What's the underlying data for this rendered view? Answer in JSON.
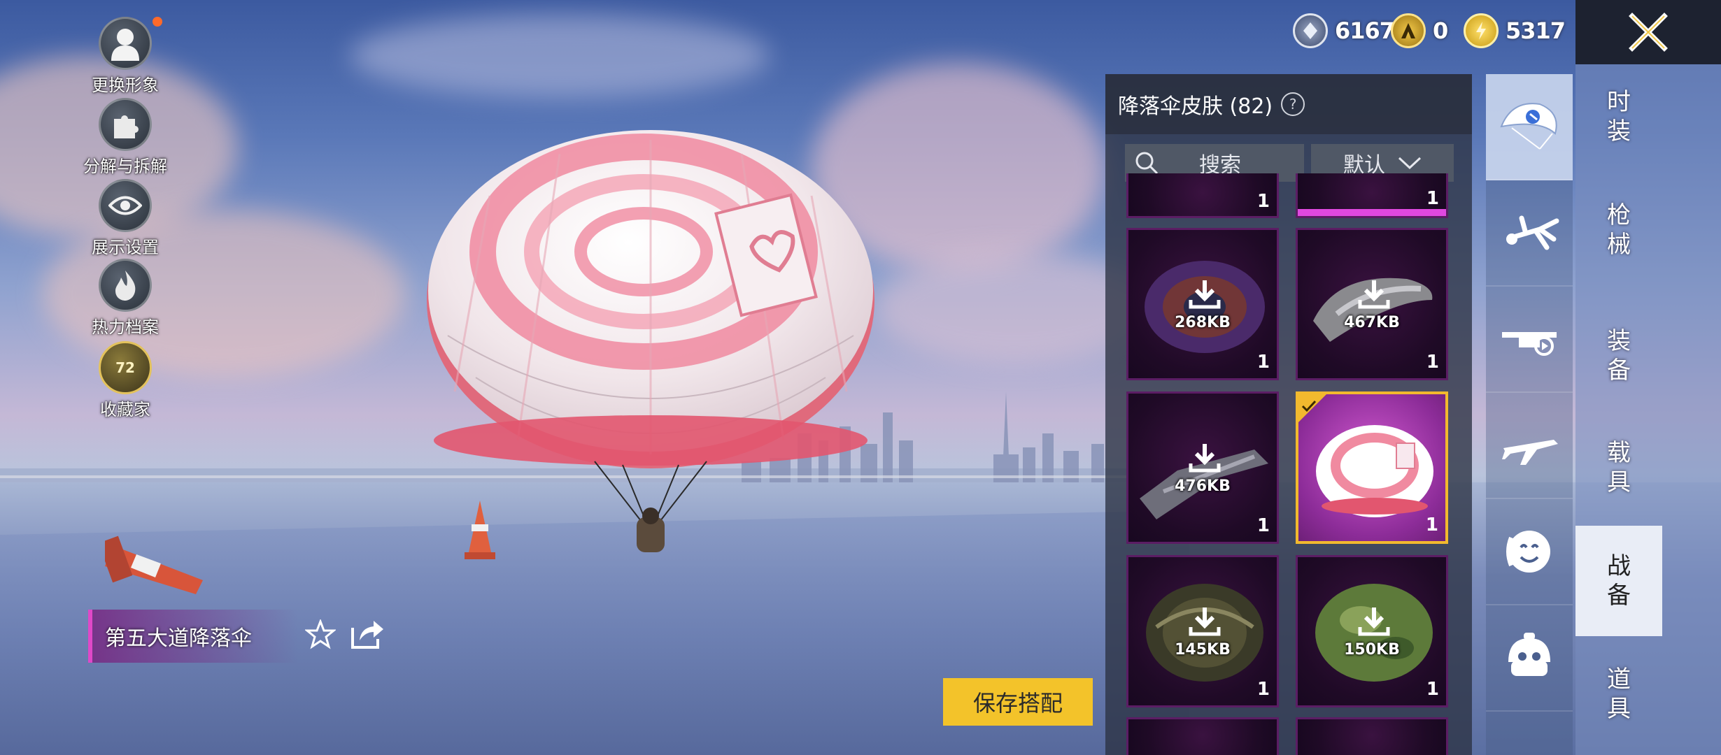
{
  "currency": [
    {
      "name": "silver-coin-icon",
      "value": "6167"
    },
    {
      "name": "ag-coin-icon",
      "value": "0"
    },
    {
      "name": "bp-coin-icon",
      "value": "5317"
    }
  ],
  "left_menu": [
    {
      "label": "更换形象"
    },
    {
      "label": "分解与拆解"
    },
    {
      "label": "展示设置"
    },
    {
      "label": "热力档案"
    },
    {
      "label": "收藏家",
      "badge": "72"
    }
  ],
  "panel": {
    "title": "降落伞皮肤 (82)",
    "help_symbol": "?",
    "search_placeholder": "搜索",
    "sort_label": "默认"
  },
  "items": [
    {
      "size": "268KB",
      "count": "1",
      "selected": false
    },
    {
      "size": "467KB",
      "count": "1",
      "selected": false
    },
    {
      "size": "476KB",
      "count": "1",
      "selected": false
    },
    {
      "size": "",
      "count": "1",
      "selected": true
    },
    {
      "size": "145KB",
      "count": "1",
      "selected": false
    },
    {
      "size": "150KB",
      "count": "1",
      "selected": false
    }
  ],
  "partial_row_counts": [
    "1",
    "1"
  ],
  "categories": [
    {
      "icon": "parachute-icon",
      "active": true
    },
    {
      "icon": "skydiving-icon",
      "active": false
    },
    {
      "icon": "drone-icon",
      "active": false
    },
    {
      "icon": "airplane-icon",
      "active": false
    },
    {
      "icon": "emote-face-icon",
      "active": false
    },
    {
      "icon": "robot-companion-icon",
      "active": false
    }
  ],
  "right_tabs": [
    {
      "label": "时装",
      "active": false
    },
    {
      "label": "枪械",
      "active": false
    },
    {
      "label": "装备",
      "active": false
    },
    {
      "label": "载具",
      "active": false
    },
    {
      "label": "战备",
      "active": true
    },
    {
      "label": "道具",
      "active": false
    }
  ],
  "current_item": {
    "name": "第五大道降落伞"
  },
  "save_button": "保存搭配",
  "colors": {
    "accent_yellow": "#f3c32a",
    "rarity_purple": "#c634c8",
    "selected_border": "#f2b92e"
  }
}
